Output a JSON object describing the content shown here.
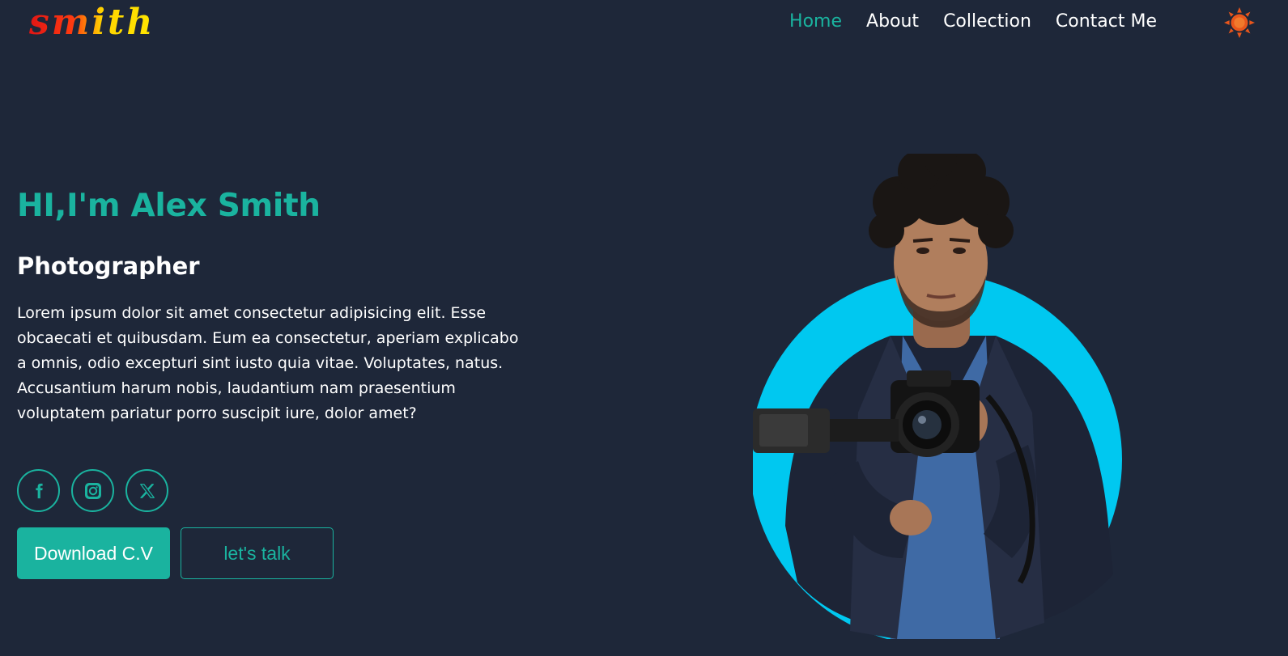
{
  "header": {
    "logo_text": "smith",
    "nav": [
      {
        "label": "Home",
        "active": true
      },
      {
        "label": "About",
        "active": false
      },
      {
        "label": "Collection",
        "active": false
      },
      {
        "label": "Contact Me",
        "active": false
      }
    ],
    "theme_toggle_icon": "sun-icon"
  },
  "hero": {
    "title": "HI,I'm Alex Smith",
    "role": "Photographer",
    "description": "Lorem ipsum dolor sit amet consectetur adipisicing elit. Esse obcaecati et quibusdam. Eum ea consectetur, aperiam explicabo a omnis, odio excepturi sint iusto quia vitae. Voluptates, natus. Accusantium harum nobis, laudantium nam praesentium voluptatem pariatur porro suscipit iure, dolor amet?",
    "socials": [
      {
        "icon": "facebook-icon"
      },
      {
        "icon": "instagram-icon"
      },
      {
        "icon": "x-twitter-icon"
      }
    ],
    "primary_button": "Download C.V",
    "secondary_button": "let's talk",
    "image_icon": "photographer-portrait"
  },
  "colors": {
    "background": "#1e2739",
    "accent": "#1ab39f",
    "circle": "#00c8f0",
    "sun": "#e8561c"
  }
}
